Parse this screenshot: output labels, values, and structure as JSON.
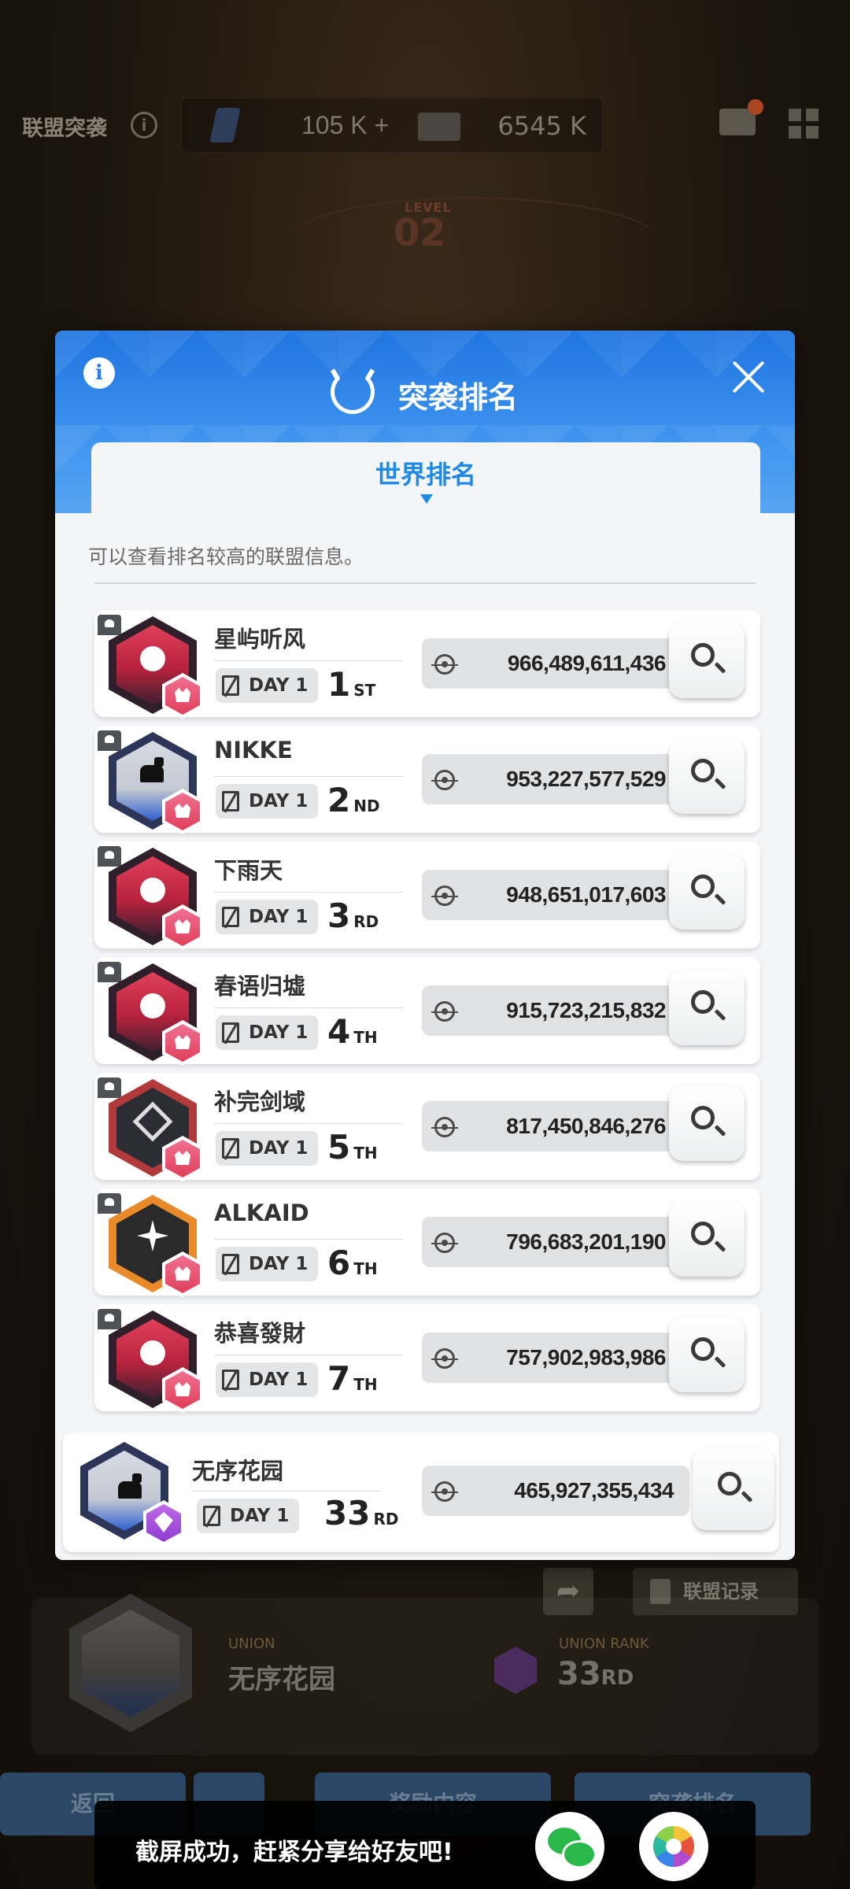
{
  "background": {
    "title": "联盟突袭",
    "resource_1": "105 K +",
    "resource_2": "6545 K",
    "level_label": "LEVEL",
    "level_value": "02",
    "union_label": "UNION",
    "union_name": "无序花园",
    "union_rank_label": "UNION RANK",
    "union_rank_num": "33",
    "union_rank_suffix": "RD",
    "record_button": "联盟记录",
    "back_button": "返回",
    "reward_button": "奖励内容",
    "ranking_button": "突袭排名"
  },
  "modal": {
    "title": "突袭排名",
    "tab": "世界排名",
    "description": "可以查看排名较高的联盟信息。"
  },
  "rows": [
    {
      "name": "星屿听风",
      "day": "DAY 1",
      "rank": "1",
      "suffix": "ST",
      "score": "966,489,611,436",
      "emblem": "sunset",
      "hex_color": "#2e1f2b",
      "inner_color": "#c9304a"
    },
    {
      "name": "NIKKE",
      "day": "DAY 1",
      "rank": "2",
      "suffix": "ND",
      "score": "953,227,577,529",
      "emblem": "cat",
      "hex_color": "#2d3658",
      "inner_color": "#d7dbe3"
    },
    {
      "name": "下雨天",
      "day": "DAY 1",
      "rank": "3",
      "suffix": "RD",
      "score": "948,651,017,603",
      "emblem": "sunset",
      "hex_color": "#2e1f2b",
      "inner_color": "#c9304a"
    },
    {
      "name": "春语归墟",
      "day": "DAY 1",
      "rank": "4",
      "suffix": "TH",
      "score": "915,723,215,832",
      "emblem": "sunset",
      "hex_color": "#2e1f2b",
      "inner_color": "#c9304a"
    },
    {
      "name": "补完剑域",
      "day": "DAY 1",
      "rank": "5",
      "suffix": "TH",
      "score": "817,450,846,276",
      "emblem": "knot",
      "hex_color": "#b23a3a",
      "inner_color": "#2c2c34"
    },
    {
      "name": "ALKAID",
      "day": "DAY 1",
      "rank": "6",
      "suffix": "TH",
      "score": "796,683,201,190",
      "emblem": "star",
      "hex_color": "#e98a2a",
      "inner_color": "#2a2a2a"
    },
    {
      "name": "恭喜發財",
      "day": "DAY 1",
      "rank": "7",
      "suffix": "TH",
      "score": "757,902,983,986",
      "emblem": "sunset",
      "hex_color": "#2e1f2b",
      "inner_color": "#c9304a"
    }
  ],
  "own_row": {
    "name": "无序花园",
    "day": "DAY 1",
    "rank": "33",
    "suffix": "RD",
    "score": "465,927,355,434"
  },
  "toast": {
    "message": "截屏成功，赶紧分享给好友吧!"
  },
  "colors": {
    "header_blue": "#1f74e0",
    "tab_blue": "#1f8ae6"
  }
}
